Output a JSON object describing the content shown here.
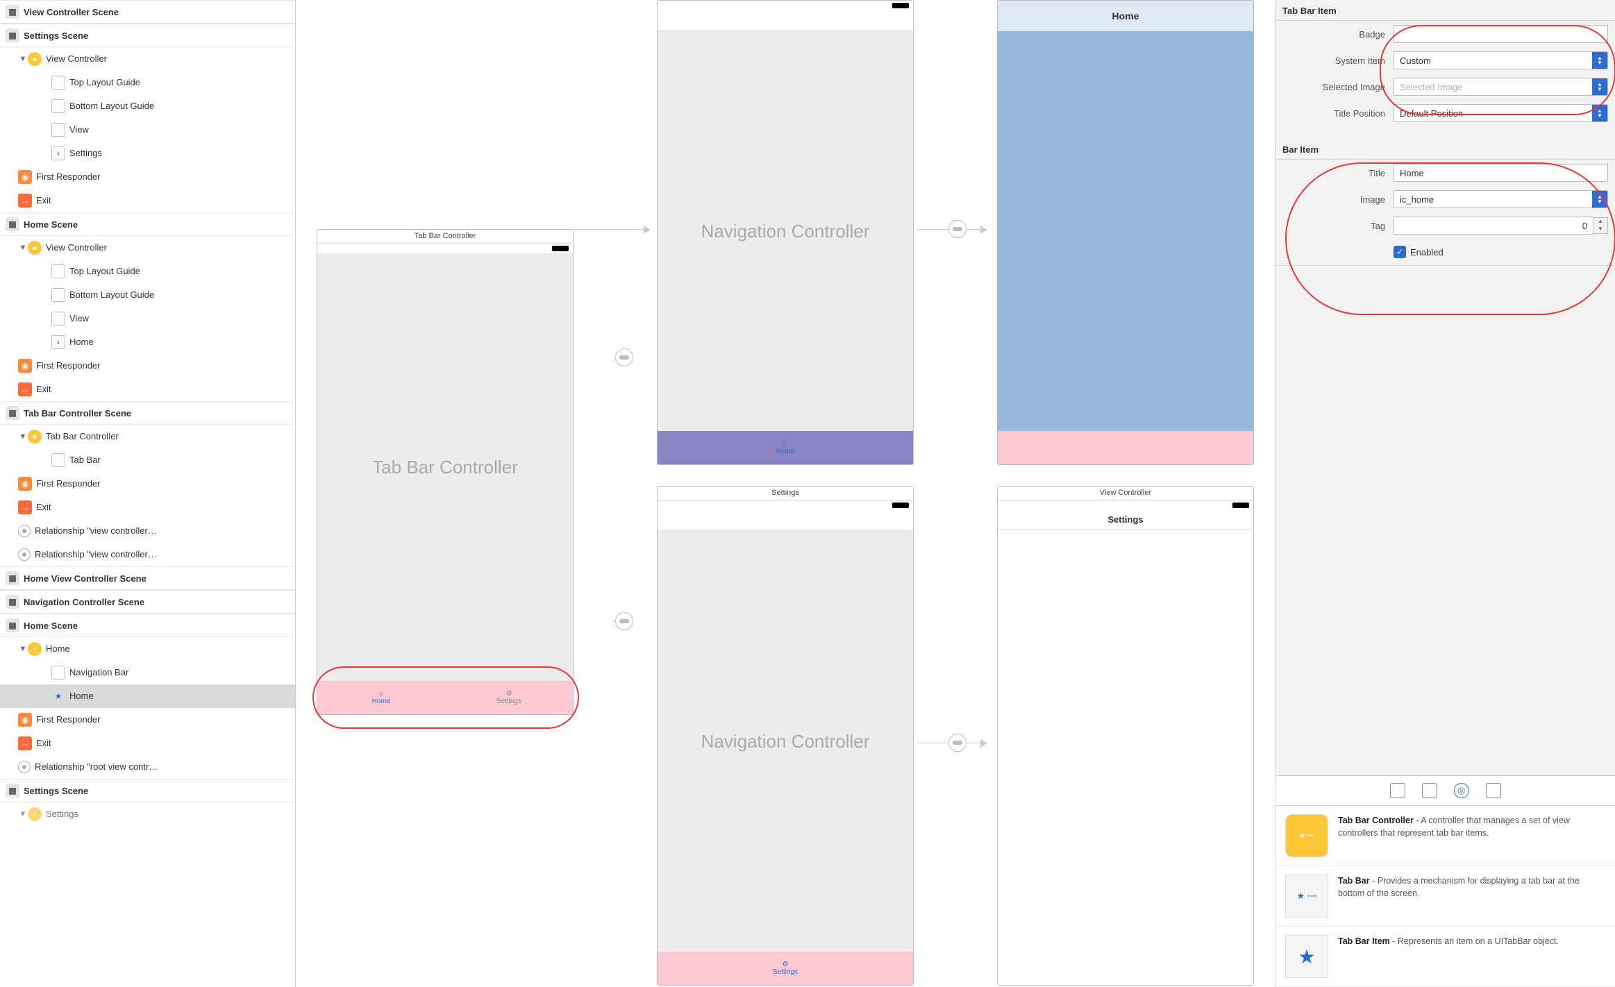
{
  "outline": {
    "scenes": [
      {
        "name": "View Controller Scene",
        "expanded": false
      },
      {
        "name": "Settings Scene",
        "expanded": true,
        "children": [
          {
            "name": "View Controller",
            "icon": "vc",
            "children": [
              {
                "name": "Top Layout Guide",
                "icon": "rect"
              },
              {
                "name": "Bottom Layout Guide",
                "icon": "rect"
              },
              {
                "name": "View",
                "icon": "rect"
              },
              {
                "name": "Settings",
                "icon": "back"
              }
            ]
          },
          {
            "name": "First Responder",
            "icon": "cube"
          },
          {
            "name": "Exit",
            "icon": "exit"
          }
        ]
      },
      {
        "name": "Home Scene",
        "expanded": true,
        "children": [
          {
            "name": "View Controller",
            "icon": "vc",
            "children": [
              {
                "name": "Top Layout Guide",
                "icon": "rect"
              },
              {
                "name": "Bottom Layout Guide",
                "icon": "rect"
              },
              {
                "name": "View",
                "icon": "rect"
              },
              {
                "name": "Home",
                "icon": "back"
              }
            ]
          },
          {
            "name": "First Responder",
            "icon": "cube"
          },
          {
            "name": "Exit",
            "icon": "exit"
          }
        ]
      },
      {
        "name": "Tab Bar Controller Scene",
        "expanded": true,
        "children": [
          {
            "name": "Tab Bar Controller",
            "icon": "vc",
            "children": [
              {
                "name": "Tab Bar",
                "icon": "tabbar"
              }
            ]
          },
          {
            "name": "First Responder",
            "icon": "cube"
          },
          {
            "name": "Exit",
            "icon": "exit"
          },
          {
            "name": "Relationship \"view controller…",
            "icon": "seg"
          },
          {
            "name": "Relationship \"view controller…",
            "icon": "seg"
          }
        ]
      },
      {
        "name": "Home View Controller Scene",
        "expanded": false
      },
      {
        "name": "Navigation Controller Scene",
        "expanded": false
      },
      {
        "name": "Home Scene",
        "expanded": true,
        "children": [
          {
            "name": "Home",
            "icon": "nav",
            "children": [
              {
                "name": "Navigation Bar",
                "icon": "rect"
              },
              {
                "name": "Home",
                "icon": "star",
                "selected": true
              }
            ]
          },
          {
            "name": "First Responder",
            "icon": "cube"
          },
          {
            "name": "Exit",
            "icon": "exit"
          },
          {
            "name": "Relationship \"root view contr…",
            "icon": "seg"
          }
        ]
      },
      {
        "name": "Settings Scene",
        "expanded": true,
        "children": [
          {
            "name": "Settings",
            "icon": "nav",
            "truncated": true
          }
        ]
      }
    ]
  },
  "canvas": {
    "tabBarController": {
      "title": "Tab Bar Controller",
      "bodyLabel": "Tab Bar Controller",
      "tabs": [
        {
          "label": "Home",
          "active": true,
          "icon": "home"
        },
        {
          "label": "Settings",
          "active": false,
          "icon": "gear"
        }
      ]
    },
    "navController1": {
      "title": "",
      "bodyLabel": "Navigation Controller",
      "bottomLabel": "Home",
      "bottomIcon": "home"
    },
    "navController2": {
      "title": "Settings",
      "bodyLabel": "Navigation Controller",
      "bottomLabel": "Settings",
      "bottomIcon": "gear"
    },
    "homeVC": {
      "navTitle": "Home"
    },
    "settingsVC": {
      "title": "View Controller",
      "navLabel": "Settings"
    }
  },
  "inspector": {
    "tabBarItem": {
      "section": "Tab Bar Item",
      "badge_label": "Badge",
      "badge_value": "",
      "system_item_label": "System Item",
      "system_item_value": "Custom",
      "selected_image_label": "Selected Image",
      "selected_image_placeholder": "Selected Image",
      "title_position_label": "Title Position",
      "title_position_value": "Default Position"
    },
    "barItem": {
      "section": "Bar Item",
      "title_label": "Title",
      "title_value": "Home",
      "image_label": "Image",
      "image_value": "ic_home",
      "tag_label": "Tag",
      "tag_value": "0",
      "enabled_label": "Enabled",
      "enabled_checked": true
    },
    "library": [
      {
        "title": "Tab Bar Controller",
        "desc": " - A controller that manages a set of view controllers that represent tab bar items.",
        "thumb": "yellow"
      },
      {
        "title": "Tab Bar",
        "desc": " - Provides a mechanism for displaying a tab bar at the bottom of the screen.",
        "thumb": "star-dots"
      },
      {
        "title": "Tab Bar Item",
        "desc": " - Represents an item on a UITabBar object.",
        "thumb": "star"
      }
    ]
  }
}
